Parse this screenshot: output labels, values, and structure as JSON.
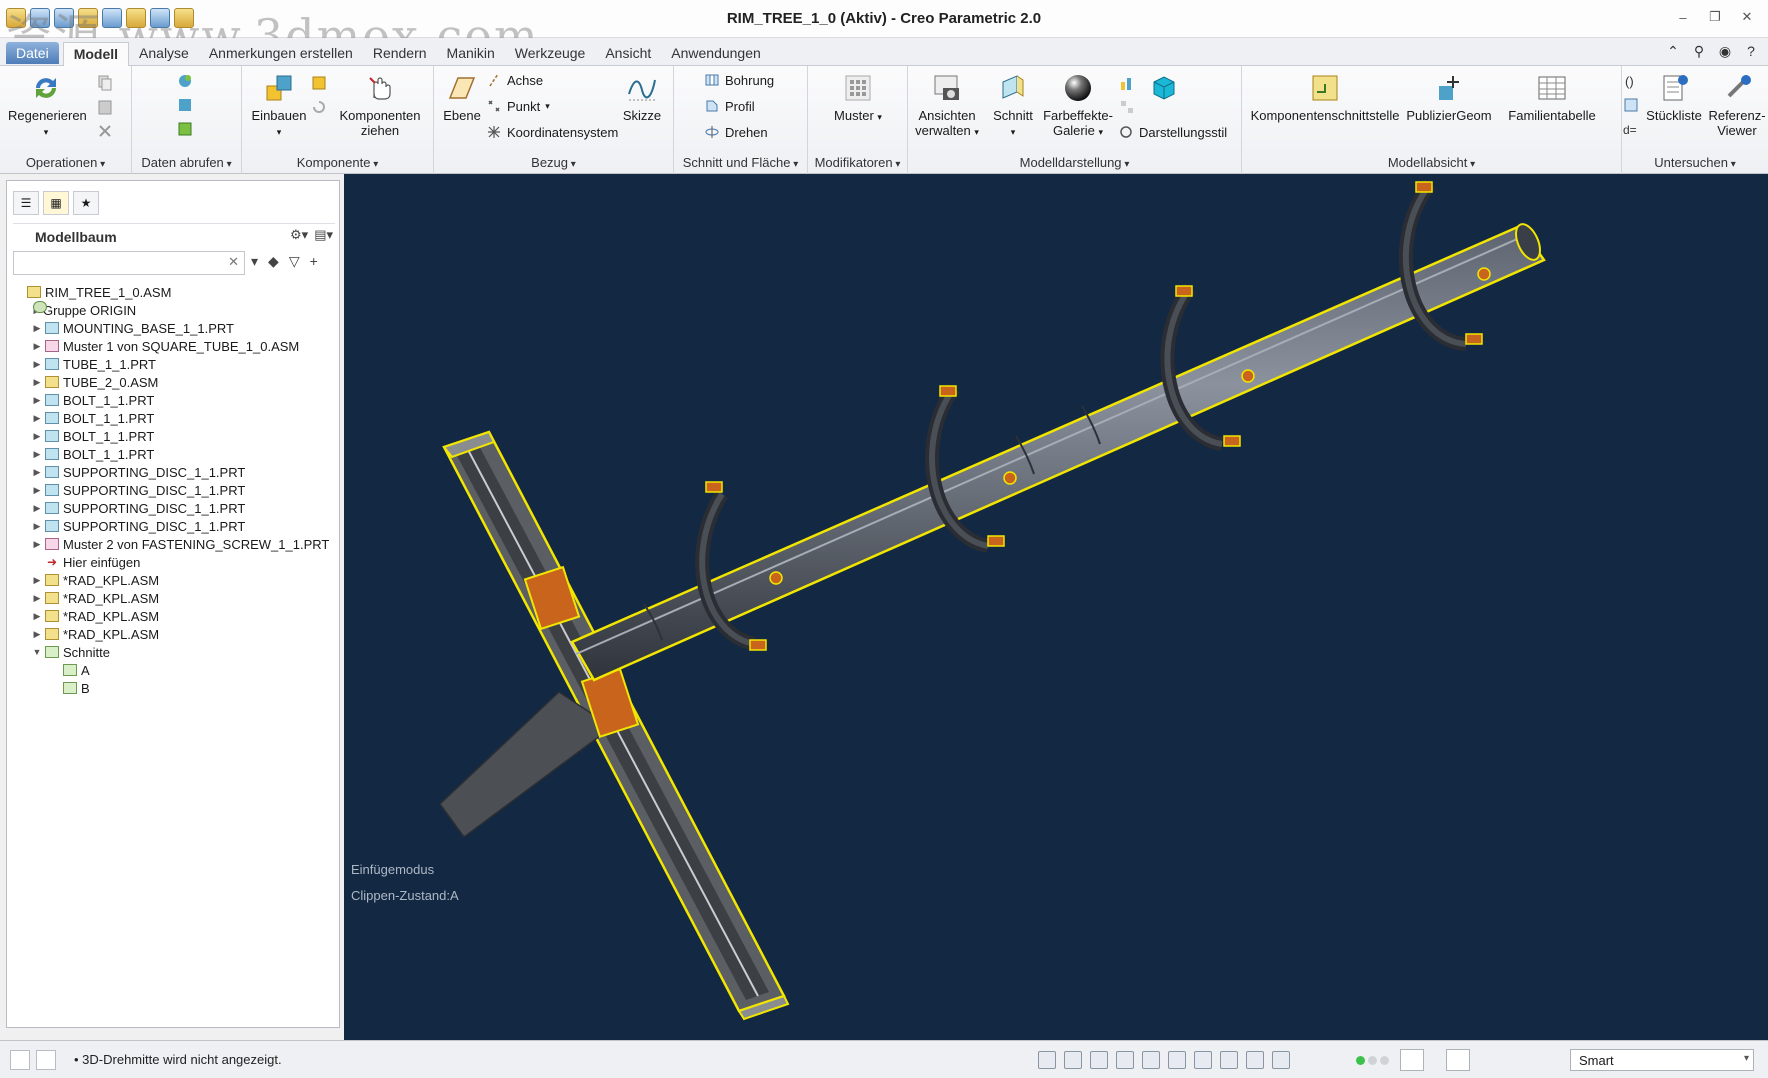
{
  "window": {
    "title": "RIM_TREE_1_0 (Aktiv) - Creo Parametric 2.0",
    "watermark": "资源  www.3dmox.com"
  },
  "menu": {
    "tabs": [
      "Datei",
      "Modell",
      "Analyse",
      "Anmerkungen erstellen",
      "Rendern",
      "Manikin",
      "Werkzeuge",
      "Ansicht",
      "Anwendungen"
    ],
    "active_tab": "Modell"
  },
  "ribbon": {
    "groups": {
      "operationen": "Operationen",
      "daten_abrufen": "Daten abrufen",
      "komponente": "Komponente",
      "bezug": "Bezug",
      "schnitt_flaeche": "Schnitt und Fläche",
      "modifikatoren": "Modifikatoren",
      "modelldarstellung": "Modelldarstellung",
      "modellabsicht": "Modellabsicht",
      "untersuchen": "Untersuchen"
    },
    "buttons": {
      "regenerieren": "Regenerieren",
      "einbauen": "Einbauen",
      "komponenten_ziehen_1": "Komponenten",
      "komponenten_ziehen_2": "ziehen",
      "ebene": "Ebene",
      "achse": "Achse",
      "punkt": "Punkt",
      "koordinatensystem": "Koordinatensystem",
      "skizze": "Skizze",
      "bohrung": "Bohrung",
      "profil": "Profil",
      "drehen": "Drehen",
      "muster": "Muster",
      "ansichten_1": "Ansichten",
      "ansichten_2": "verwalten",
      "schnitt": "Schnitt",
      "farbeffekte_1": "Farbeffekte-",
      "farbeffekte_2": "Galerie",
      "darstellungsstil": "Darstellungsstil",
      "komponentenschnittstelle": "Komponentenschnittstelle",
      "publiziergeom": "PublizierGeom",
      "familientabelle": "Familientabelle",
      "stueckliste": "Stückliste",
      "referenz_1": "Referenz-",
      "referenz_2": "Viewer"
    }
  },
  "panel": {
    "title": "Modellbaum",
    "search_value": "",
    "tree": [
      {
        "label": "RIM_TREE_1_0.ASM",
        "icon": "asm",
        "level": 0,
        "exp": ""
      },
      {
        "label": "Gruppe ORIGIN",
        "icon": "grp",
        "level": 1,
        "exp": "▶"
      },
      {
        "label": "MOUNTING_BASE_1_1.PRT",
        "icon": "prt",
        "level": 1,
        "exp": "▶"
      },
      {
        "label": "Muster 1 von SQUARE_TUBE_1_0.ASM",
        "icon": "pat",
        "level": 1,
        "exp": "▶"
      },
      {
        "label": "TUBE_1_1.PRT",
        "icon": "prt",
        "level": 1,
        "exp": "▶"
      },
      {
        "label": "TUBE_2_0.ASM",
        "icon": "asm",
        "level": 1,
        "exp": "▶"
      },
      {
        "label": "BOLT_1_1.PRT",
        "icon": "prt",
        "level": 1,
        "exp": "▶"
      },
      {
        "label": "BOLT_1_1.PRT",
        "icon": "prt",
        "level": 1,
        "exp": "▶"
      },
      {
        "label": "BOLT_1_1.PRT",
        "icon": "prt",
        "level": 1,
        "exp": "▶"
      },
      {
        "label": "BOLT_1_1.PRT",
        "icon": "prt",
        "level": 1,
        "exp": "▶"
      },
      {
        "label": "SUPPORTING_DISC_1_1.PRT",
        "icon": "prt",
        "level": 1,
        "exp": "▶"
      },
      {
        "label": "SUPPORTING_DISC_1_1.PRT",
        "icon": "prt",
        "level": 1,
        "exp": "▶"
      },
      {
        "label": "SUPPORTING_DISC_1_1.PRT",
        "icon": "prt",
        "level": 1,
        "exp": "▶"
      },
      {
        "label": "SUPPORTING_DISC_1_1.PRT",
        "icon": "prt",
        "level": 1,
        "exp": "▶"
      },
      {
        "label": "Muster 2 von FASTENING_SCREW_1_1.PRT",
        "icon": "pat",
        "level": 1,
        "exp": "▶"
      },
      {
        "label": "Hier einfügen",
        "icon": "ins",
        "level": 1,
        "exp": ""
      },
      {
        "label": "*RAD_KPL.ASM",
        "icon": "asm",
        "level": 1,
        "exp": "▶"
      },
      {
        "label": "*RAD_KPL.ASM",
        "icon": "asm",
        "level": 1,
        "exp": "▶"
      },
      {
        "label": "*RAD_KPL.ASM",
        "icon": "asm",
        "level": 1,
        "exp": "▶"
      },
      {
        "label": "*RAD_KPL.ASM",
        "icon": "asm",
        "level": 1,
        "exp": "▶"
      },
      {
        "label": "Schnitte",
        "icon": "sec",
        "level": 1,
        "exp": "▼"
      },
      {
        "label": "A",
        "icon": "sec",
        "level": 2,
        "exp": ""
      },
      {
        "label": "B",
        "icon": "sec",
        "level": 2,
        "exp": ""
      }
    ]
  },
  "viewport": {
    "mode_text": "Einfügemodus",
    "clip_text": "Clippen-Zustand:A",
    "colors": {
      "background": "#132843",
      "outline": "#f2e600",
      "section": "#c8641c"
    }
  },
  "status": {
    "message": "3D-Drehmitte wird nicht angezeigt.",
    "filter_value": "Smart"
  }
}
